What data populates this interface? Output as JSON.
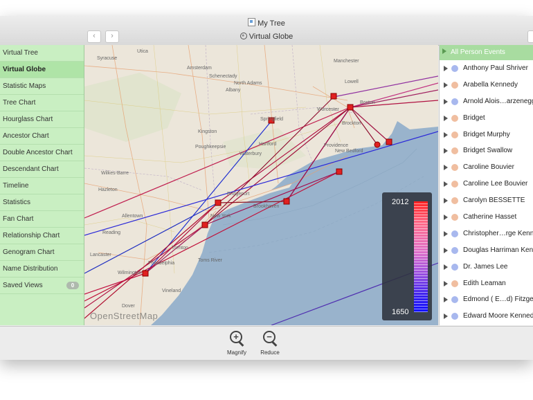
{
  "window": {
    "title": "My Tree",
    "subtitle": "Virtual Globe",
    "back_icon": "‹",
    "forward_icon": "›"
  },
  "sidebar": {
    "items": [
      {
        "label": "Virtual Tree"
      },
      {
        "label": "Virtual Globe",
        "active": true
      },
      {
        "label": "Statistic Maps"
      },
      {
        "label": "Tree Chart"
      },
      {
        "label": "Hourglass Chart"
      },
      {
        "label": "Ancestor Chart"
      },
      {
        "label": "Double Ancestor Chart"
      },
      {
        "label": "Descendant Chart"
      },
      {
        "label": "Timeline"
      },
      {
        "label": "Statistics"
      },
      {
        "label": "Fan Chart"
      },
      {
        "label": "Relationship Chart"
      },
      {
        "label": "Genogram Chart"
      },
      {
        "label": "Name Distribution"
      },
      {
        "label": "Saved Views",
        "badge": "0"
      }
    ]
  },
  "map": {
    "attribution": "OpenStreetMap",
    "labels": {
      "syracuse": "Syracuse",
      "utica": "Utica",
      "amsterdam": "Amsterdam",
      "schenectady": "Schenectady",
      "albany": "Albany",
      "north_adams": "North Adams",
      "lowell": "Lowell",
      "manchester": "Manchester",
      "boston": "Boston",
      "springfield": "Springfield",
      "worcester": "Worcester",
      "kingston": "Kingston",
      "poughkeepsie": "Poughkeepsie",
      "hartford": "Hartford",
      "waterbury": "Waterbury",
      "providence": "Providence",
      "brockton": "Brockton",
      "new_bedford": "New Bedford",
      "wilkes_barre": "Wilkes-Barre",
      "hazleton": "Hazleton",
      "allentown": "Allentown",
      "bridgeport": "Bridgeport",
      "new_york": "New York",
      "brookhaven": "Brookhaven",
      "reading": "Reading",
      "trenton": "Trenton",
      "toms_river": "Toms River",
      "lancaster": "Lancaster",
      "philadelphia": "Philadelphia",
      "wilmington": "Wilmington",
      "dover": "Dover",
      "vineland": "Vineland"
    },
    "legend": {
      "max_year": "2012",
      "min_year": "1650"
    }
  },
  "people": {
    "header": "All Person Events",
    "female_color": "#f0bea0",
    "male_color": "#a8b8ee",
    "items": [
      {
        "name": "Anthony Paul Shriver",
        "gender": "male"
      },
      {
        "name": "Arabella Kennedy",
        "gender": "female"
      },
      {
        "name": "Arnold Alois…arzenegger",
        "gender": "male"
      },
      {
        "name": "Bridget",
        "gender": "female"
      },
      {
        "name": "Bridget Murphy",
        "gender": "female"
      },
      {
        "name": "Bridget Swallow",
        "gender": "female"
      },
      {
        "name": "Caroline Bouvier",
        "gender": "female"
      },
      {
        "name": "Caroline Lee Bouvier",
        "gender": "female"
      },
      {
        "name": "Carolyn BESSETTE",
        "gender": "female"
      },
      {
        "name": "Catherine Hasset",
        "gender": "female"
      },
      {
        "name": "Christopher…rge Kennedy",
        "gender": "male"
      },
      {
        "name": "Douglas Harriman Kennedy",
        "gender": "male"
      },
      {
        "name": "Dr. James Lee",
        "gender": "male"
      },
      {
        "name": "Edith Leaman",
        "gender": "female"
      },
      {
        "name": "Edmond ( E…d) Fitzgerald",
        "gender": "male"
      },
      {
        "name": "Edward Moore Kennedy",
        "gender": "male"
      }
    ]
  },
  "toolbar": {
    "magnify_label": "Magnify",
    "reduce_label": "Reduce"
  }
}
